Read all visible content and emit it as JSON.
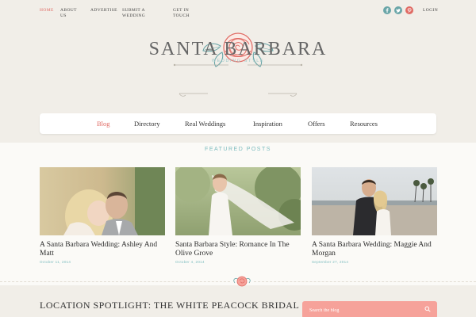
{
  "top_nav": {
    "items": [
      "HOME",
      "ABOUT US",
      "ADVERTISE",
      "SUBMIT A WEDDING",
      "GET IN TOUCH"
    ],
    "active": "HOME",
    "login": "LOGIN"
  },
  "social": [
    {
      "icon": "facebook-icon",
      "color": "#6aa6a8"
    },
    {
      "icon": "twitter-icon",
      "color": "#6aa6a8"
    },
    {
      "icon": "pinterest-icon",
      "color": "#e06a63"
    }
  ],
  "site": {
    "title": "SANTA BARBARA",
    "subtitle": "WEDDING STYLE"
  },
  "main_nav": {
    "items": [
      "Blog",
      "Directory",
      "Real Weddings",
      "Inspiration",
      "Offers",
      "Resources"
    ],
    "active": "Blog"
  },
  "featured": {
    "heading": "FEATURED POSTS",
    "posts": [
      {
        "title": "A Santa Barbara Wedding: Ashley And Matt",
        "date": "October 11, 2014"
      },
      {
        "title": "Santa Barbara Style: Romance In The Olive Grove",
        "date": "October 4, 2014"
      },
      {
        "title": "A Santa Barbara Wedding: Maggie And Morgan",
        "date": "September 27, 2014"
      }
    ]
  },
  "spotlight": {
    "title": "LOCATION SPOTLIGHT: THE WHITE PEACOCK BRIDAL"
  },
  "search": {
    "placeholder": "Search the blog"
  },
  "colors": {
    "accent": "#e06a63",
    "teal": "#7cbcbf",
    "search_bg": "#f6a29a",
    "background": "#f1eee8"
  }
}
